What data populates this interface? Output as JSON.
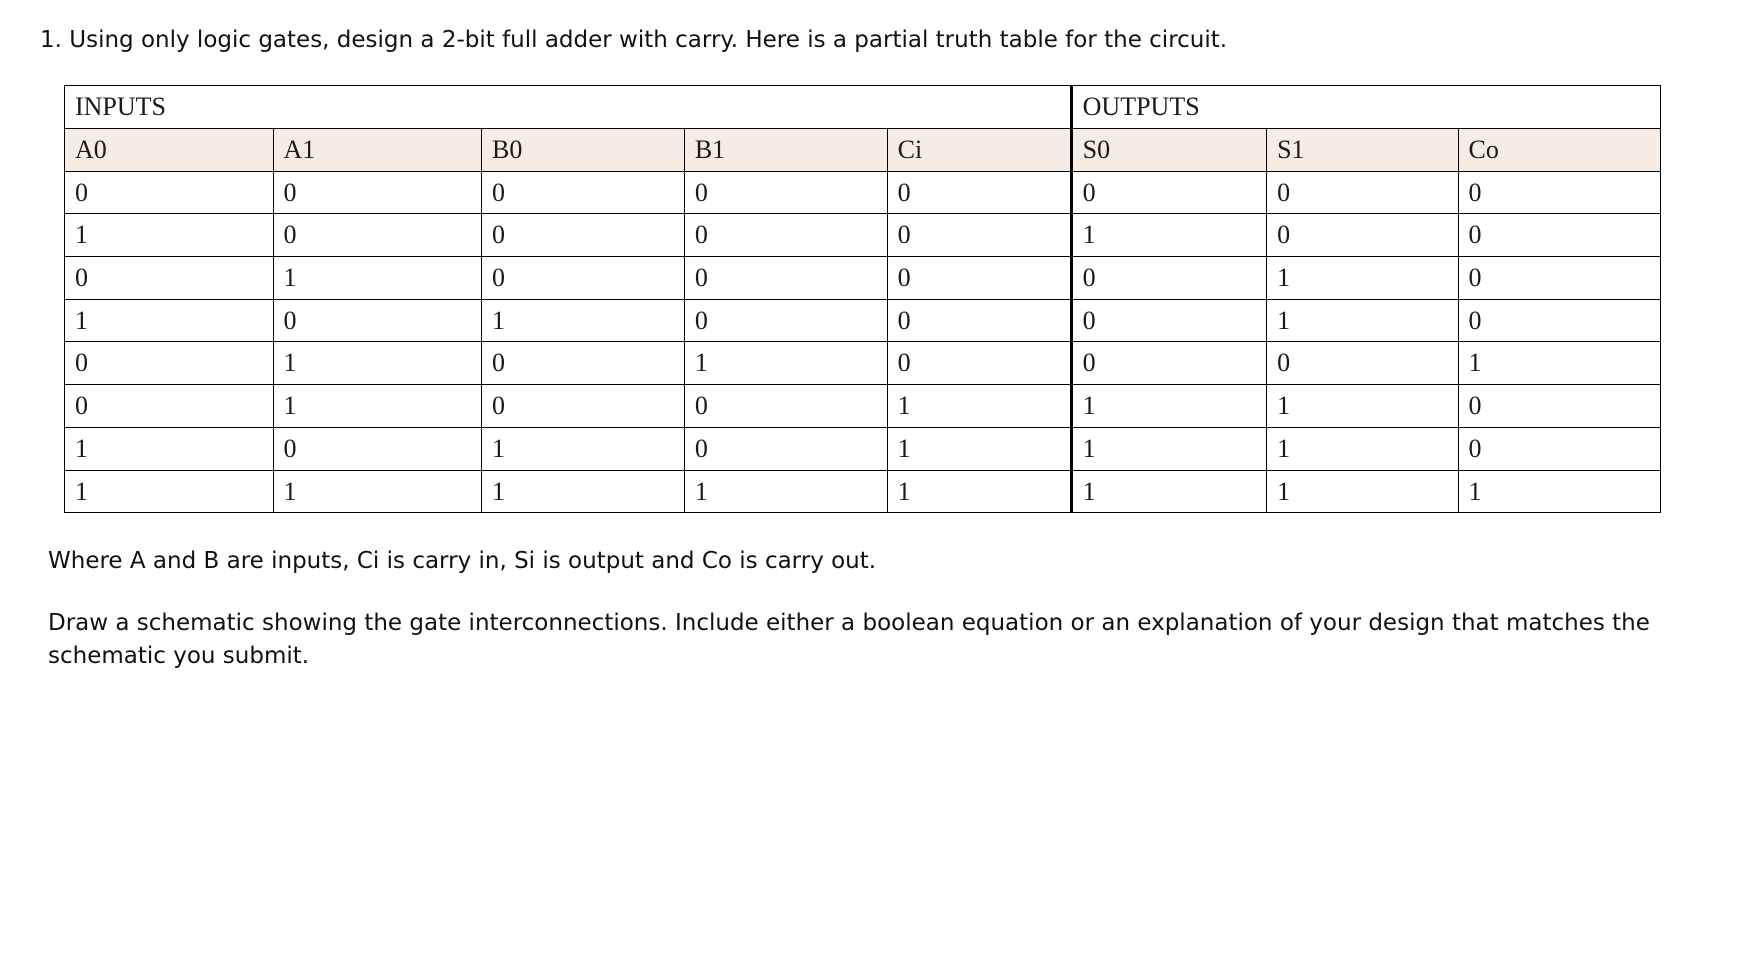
{
  "question": {
    "number_prefix": "1.",
    "text": "Using only logic gates, design a 2-bit full adder with carry. Here is a partial truth table for the circuit."
  },
  "table": {
    "group_headers": [
      "INPUTS",
      "OUTPUTS"
    ],
    "columns": [
      "A0",
      "A1",
      "B0",
      "B1",
      "Ci",
      "S0",
      "S1",
      "Co"
    ],
    "input_col_count": 5,
    "output_col_count": 3,
    "rows": [
      [
        "0",
        "0",
        "0",
        "0",
        "0",
        "0",
        "0",
        "0"
      ],
      [
        "1",
        "0",
        "0",
        "0",
        "0",
        "1",
        "0",
        "0"
      ],
      [
        "0",
        "1",
        "0",
        "0",
        "0",
        "0",
        "1",
        "0"
      ],
      [
        "1",
        "0",
        "1",
        "0",
        "0",
        "0",
        "1",
        "0"
      ],
      [
        "0",
        "1",
        "0",
        "1",
        "0",
        "0",
        "0",
        "1"
      ],
      [
        "0",
        "1",
        "0",
        "0",
        "1",
        "1",
        "1",
        "0"
      ],
      [
        "1",
        "0",
        "1",
        "0",
        "1",
        "1",
        "1",
        "0"
      ],
      [
        "1",
        "1",
        "1",
        "1",
        "1",
        "1",
        "1",
        "1"
      ]
    ]
  },
  "legend": "Where A and B are inputs, Ci is carry in, Si is output and Co is carry out.",
  "task": "Draw a schematic showing the gate interconnections. Include either a boolean equation or an explanation of your design that matches the schematic you submit."
}
